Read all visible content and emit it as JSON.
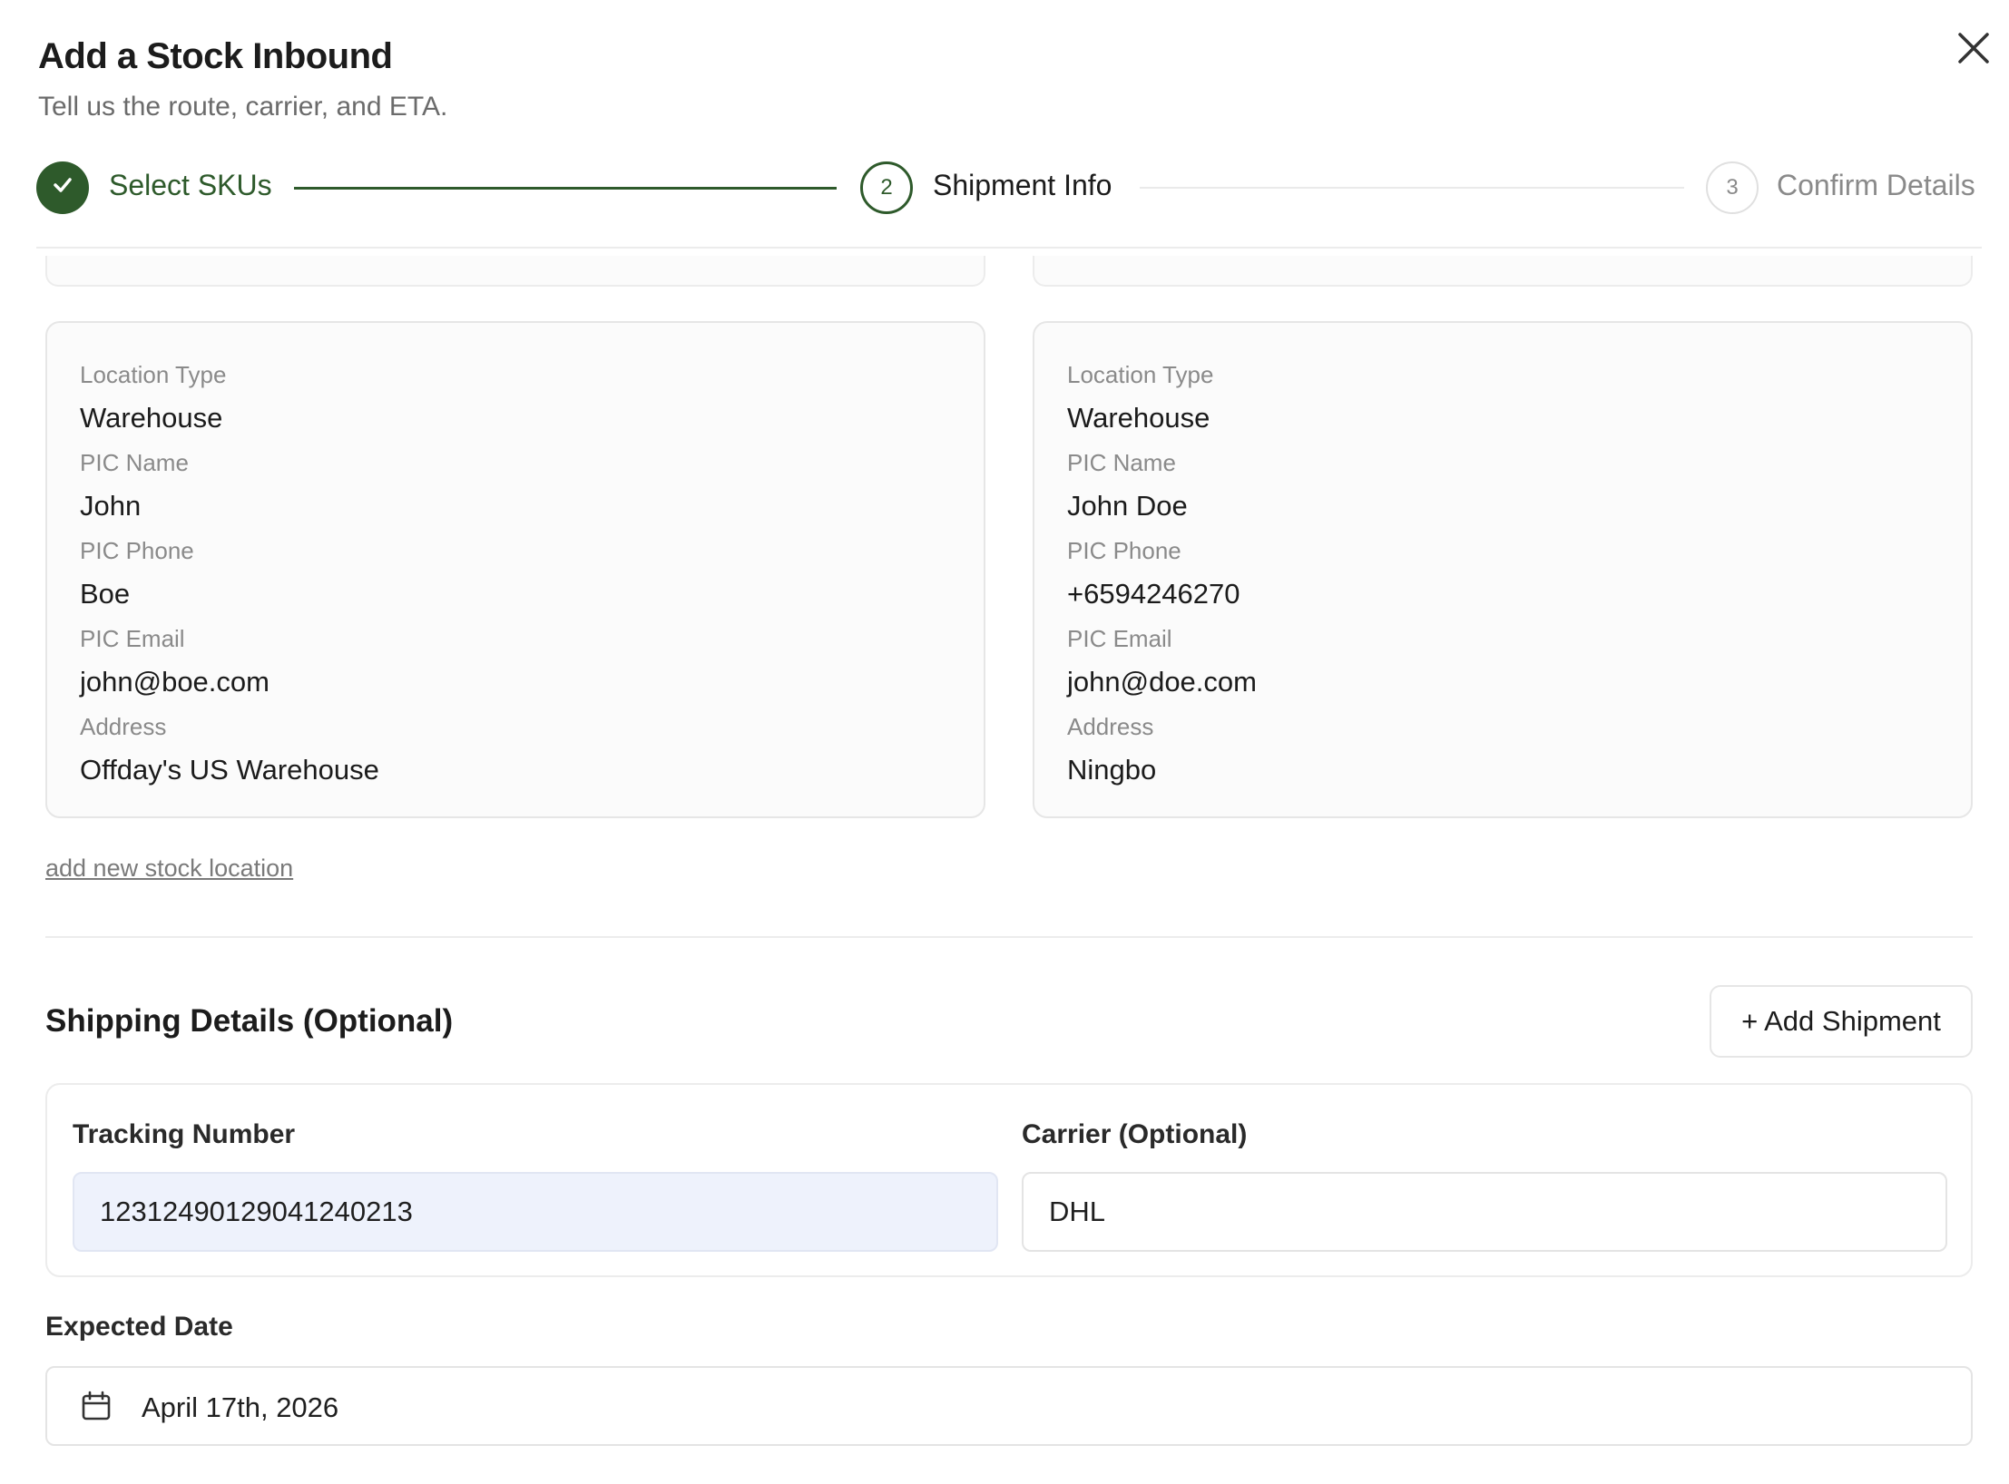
{
  "dialog": {
    "title": "Add a Stock Inbound",
    "subtitle": "Tell us the route, carrier, and ETA."
  },
  "stepper": {
    "steps": [
      {
        "number": "1",
        "label": "Select SKUs",
        "state": "completed"
      },
      {
        "number": "2",
        "label": "Shipment Info",
        "state": "active"
      },
      {
        "number": "3",
        "label": "Confirm Details",
        "state": "pending"
      }
    ]
  },
  "locations": [
    {
      "fields": [
        {
          "label": "Location Type",
          "value": "Warehouse"
        },
        {
          "label": "PIC Name",
          "value": "John"
        },
        {
          "label": "PIC Phone",
          "value": "Boe"
        },
        {
          "label": "PIC Email",
          "value": "john@boe.com"
        },
        {
          "label": "Address",
          "value": "Offday's US Warehouse"
        }
      ]
    },
    {
      "fields": [
        {
          "label": "Location Type",
          "value": "Warehouse"
        },
        {
          "label": "PIC Name",
          "value": "John Doe"
        },
        {
          "label": "PIC Phone",
          "value": "+6594246270"
        },
        {
          "label": "PIC Email",
          "value": "john@doe.com"
        },
        {
          "label": "Address",
          "value": "Ningbo"
        }
      ]
    }
  ],
  "add_location_link": "add new stock location",
  "shipping": {
    "title": "Shipping Details (Optional)",
    "add_button": "+ Add Shipment",
    "tracking_label": "Tracking Number",
    "tracking_value": "12312490129041240213",
    "carrier_label": "Carrier (Optional)",
    "carrier_value": "DHL",
    "expected_date_label": "Expected Date",
    "expected_date_value": "April 17th, 2026"
  },
  "icons": {
    "close": "close-icon",
    "check": "check-icon",
    "calendar": "calendar-icon"
  },
  "colors": {
    "accent": "#2e5a2b",
    "tracking_bg": "#eef2fc"
  }
}
